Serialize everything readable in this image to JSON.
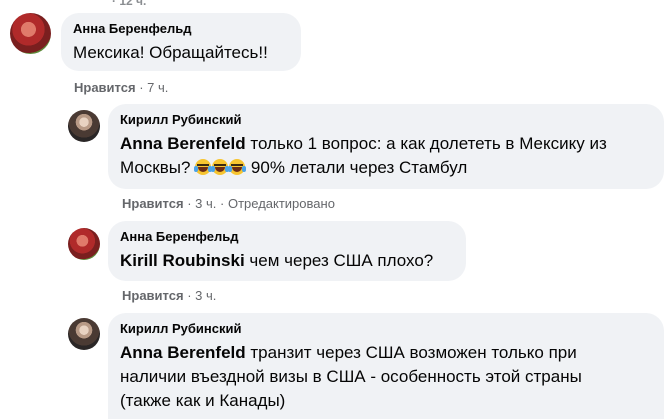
{
  "top_fragment": "· 12 ч.",
  "comments": [
    {
      "author": "Анна Беренфельд",
      "text": "Мексика! Обращайтесь!!",
      "like_label": "Нравится",
      "time": "7 ч."
    },
    {
      "author": "Кирилл Рубинский",
      "mention": "Anna Berenfeld",
      "text_line1": "только 1 вопрос: а как долететь в Мексику из",
      "text_line2_start": "Москвы?",
      "emojis": [
        "tears-of-joy-emoji",
        "tears-of-joy-emoji",
        "tears-of-joy-emoji"
      ],
      "text_line2_end": "90% летали через Стамбул",
      "like_label": "Нравится",
      "time": "3 ч.",
      "edited_label": "Отредактировано"
    },
    {
      "author": "Анна Беренфельд",
      "mention": "Kirill Roubinski",
      "text": "чем через США плохо?",
      "like_label": "Нравится",
      "time": "3 ч."
    },
    {
      "author": "Кирилл Рубинский",
      "mention": "Anna Berenfeld",
      "text_line1": "транзит через США возможен только при",
      "text_line2": "наличии въездной визы в США - особенность этой страны",
      "text_line3": "(также как и Канады)"
    }
  ]
}
